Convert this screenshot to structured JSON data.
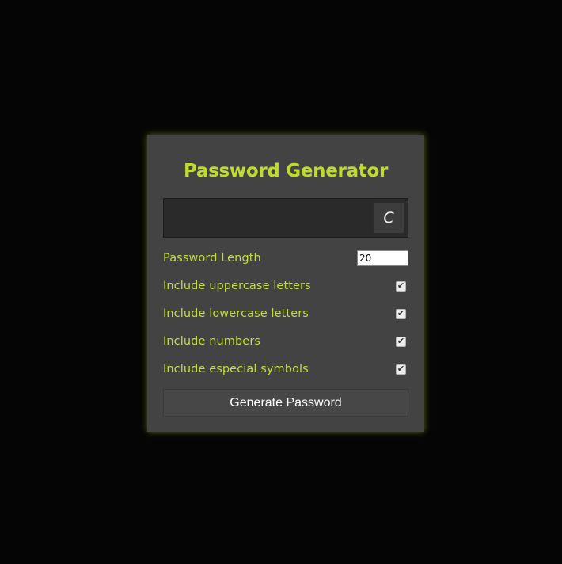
{
  "app": {
    "title": "Password Generator",
    "accent_color": "#bfdc2c",
    "background_color": "#050505",
    "card_color": "#434343"
  },
  "result": {
    "value": "",
    "copy_label": "C"
  },
  "settings": {
    "length": {
      "label": "Password Length",
      "value": "20"
    },
    "uppercase": {
      "label": "Include uppercase letters",
      "checked": true
    },
    "lowercase": {
      "label": "Include lowercase letters",
      "checked": true
    },
    "numbers": {
      "label": "Include numbers",
      "checked": true
    },
    "symbols": {
      "label": "Include especial symbols",
      "checked": true
    }
  },
  "actions": {
    "generate_label": "Generate Password"
  }
}
